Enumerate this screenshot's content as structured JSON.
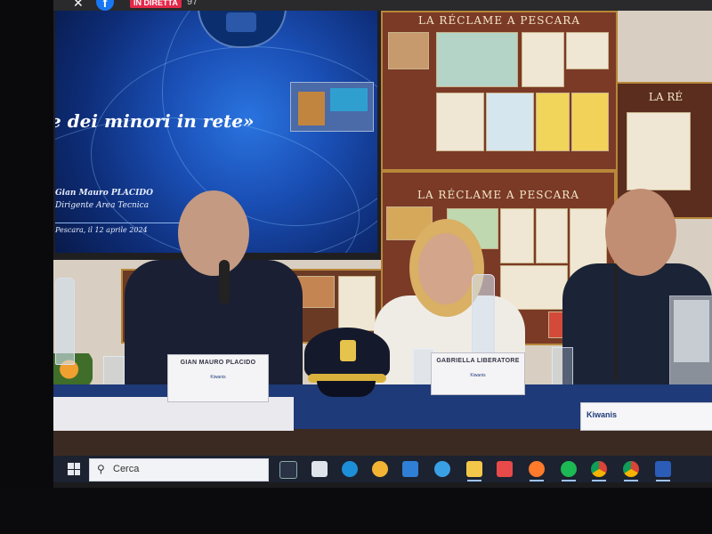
{
  "stream": {
    "live_label": "IN DIRETTA",
    "viewers_text": "97"
  },
  "projection": {
    "title": "e dei minori in rete»",
    "speaker": "Gian Mauro PLACIDO",
    "role": "Dirigente Area  Tecnica",
    "date": "Pescara, il 12 aprile 2024"
  },
  "posters": {
    "top_heading": "LA RÉCLAME A PESCARA",
    "middle_heading": "LA RÉCLAME A PESCARA",
    "right_heading": "LA RÉ"
  },
  "name_cards": [
    {
      "name": "GIAN MAURO PLACIDO",
      "logos": "Kiwanis"
    },
    {
      "name": "GABRIELLA LIBERATORE",
      "logos": "Kiwanis"
    }
  ],
  "banner": {
    "label": "Kiwanis"
  },
  "taskbar": {
    "search_placeholder": "Cerca",
    "icons": [
      "task-view-icon",
      "store-icon",
      "edge-icon",
      "chrome-canary-icon",
      "mail-icon",
      "ie-icon",
      "file-explorer-icon",
      "gift-icon",
      "firefox-icon",
      "spotify-icon",
      "chrome-icon",
      "chrome-icon-2",
      "word-icon"
    ]
  },
  "colors": {
    "taskbar": "#1c2230",
    "live_badge": "#e4294a",
    "projection_blue": "#1a4fb5",
    "table_blue": "#1e3a78"
  }
}
